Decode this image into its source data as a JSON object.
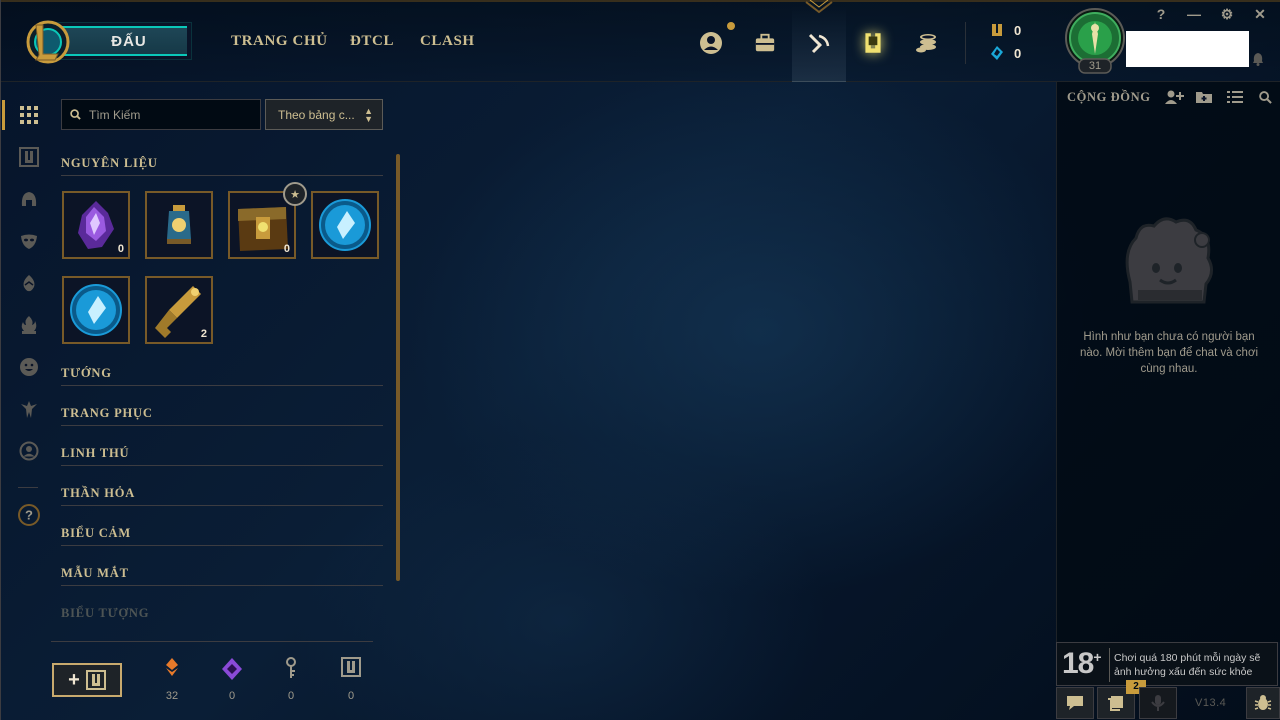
{
  "header": {
    "play_label": "ĐẤU",
    "nav": [
      {
        "label": "TRANG CHỦ"
      },
      {
        "label": "ĐTCL"
      },
      {
        "label": "CLASH"
      }
    ],
    "icons": [
      "profile-icon",
      "collection-icon",
      "loot-icon",
      "store-icon",
      "currency-stack-icon"
    ],
    "active_icon": "loot-icon",
    "currency": {
      "blue_essence_label": "0",
      "riot_points_label": "0"
    },
    "profile": {
      "level": "31"
    },
    "window_controls": [
      "?",
      "—",
      "⚙",
      "✕"
    ]
  },
  "sidebar": {
    "items": [
      "grid-icon",
      "chest-icon",
      "helmet-icon",
      "mask-icon",
      "egg-icon",
      "flame-icon",
      "smile-icon",
      "ward-icon",
      "profile-icon",
      "help-icon"
    ]
  },
  "loot": {
    "search_placeholder": "Tìm Kiếm",
    "sort_label": "Theo bảng c...",
    "sections": {
      "materials": "NGUYÊN LIỆU",
      "champions": "TƯỚNG",
      "skins": "TRANG PHỤC",
      "pets": "LINH THÚ",
      "totems": "THẦN HỎA",
      "emotes": "BIỂU CẢM",
      "ward_skins": "MẪU MẮT",
      "icons": "BIỂU TƯỢNG"
    },
    "items": [
      {
        "name": "mythic-orb",
        "count": "0"
      },
      {
        "name": "lantern",
        "count": ""
      },
      {
        "name": "hextech-chest",
        "count": "0"
      },
      {
        "name": "blue-essence-orb",
        "count": ""
      },
      {
        "name": "blue-essence-orb-2",
        "count": ""
      },
      {
        "name": "hextech-key",
        "count": "2"
      }
    ],
    "materials_bar": [
      {
        "name": "orange-essence-icon",
        "count": "32"
      },
      {
        "name": "mythic-essence-icon",
        "count": "0"
      },
      {
        "name": "key-fragment-icon",
        "count": "0"
      },
      {
        "name": "chest-icon",
        "count": "0"
      }
    ]
  },
  "social": {
    "title": "CỘNG ĐỒNG",
    "empty_message": "Hình như bạn chưa có người bạn nào. Mời thêm bạn để chat và chơi cùng nhau.",
    "warning_age": "18",
    "warning_text": "Chơi quá 180 phút mỗi ngày sẽ ảnh hưởng xấu đến sức khỏe",
    "missions_badge": "2",
    "version": "V13.4"
  },
  "colors": {
    "gold": "#c89b3c",
    "gold_light": "#cdbe91",
    "teal": "#0ac8b9",
    "panel_dark": "#010a13"
  }
}
